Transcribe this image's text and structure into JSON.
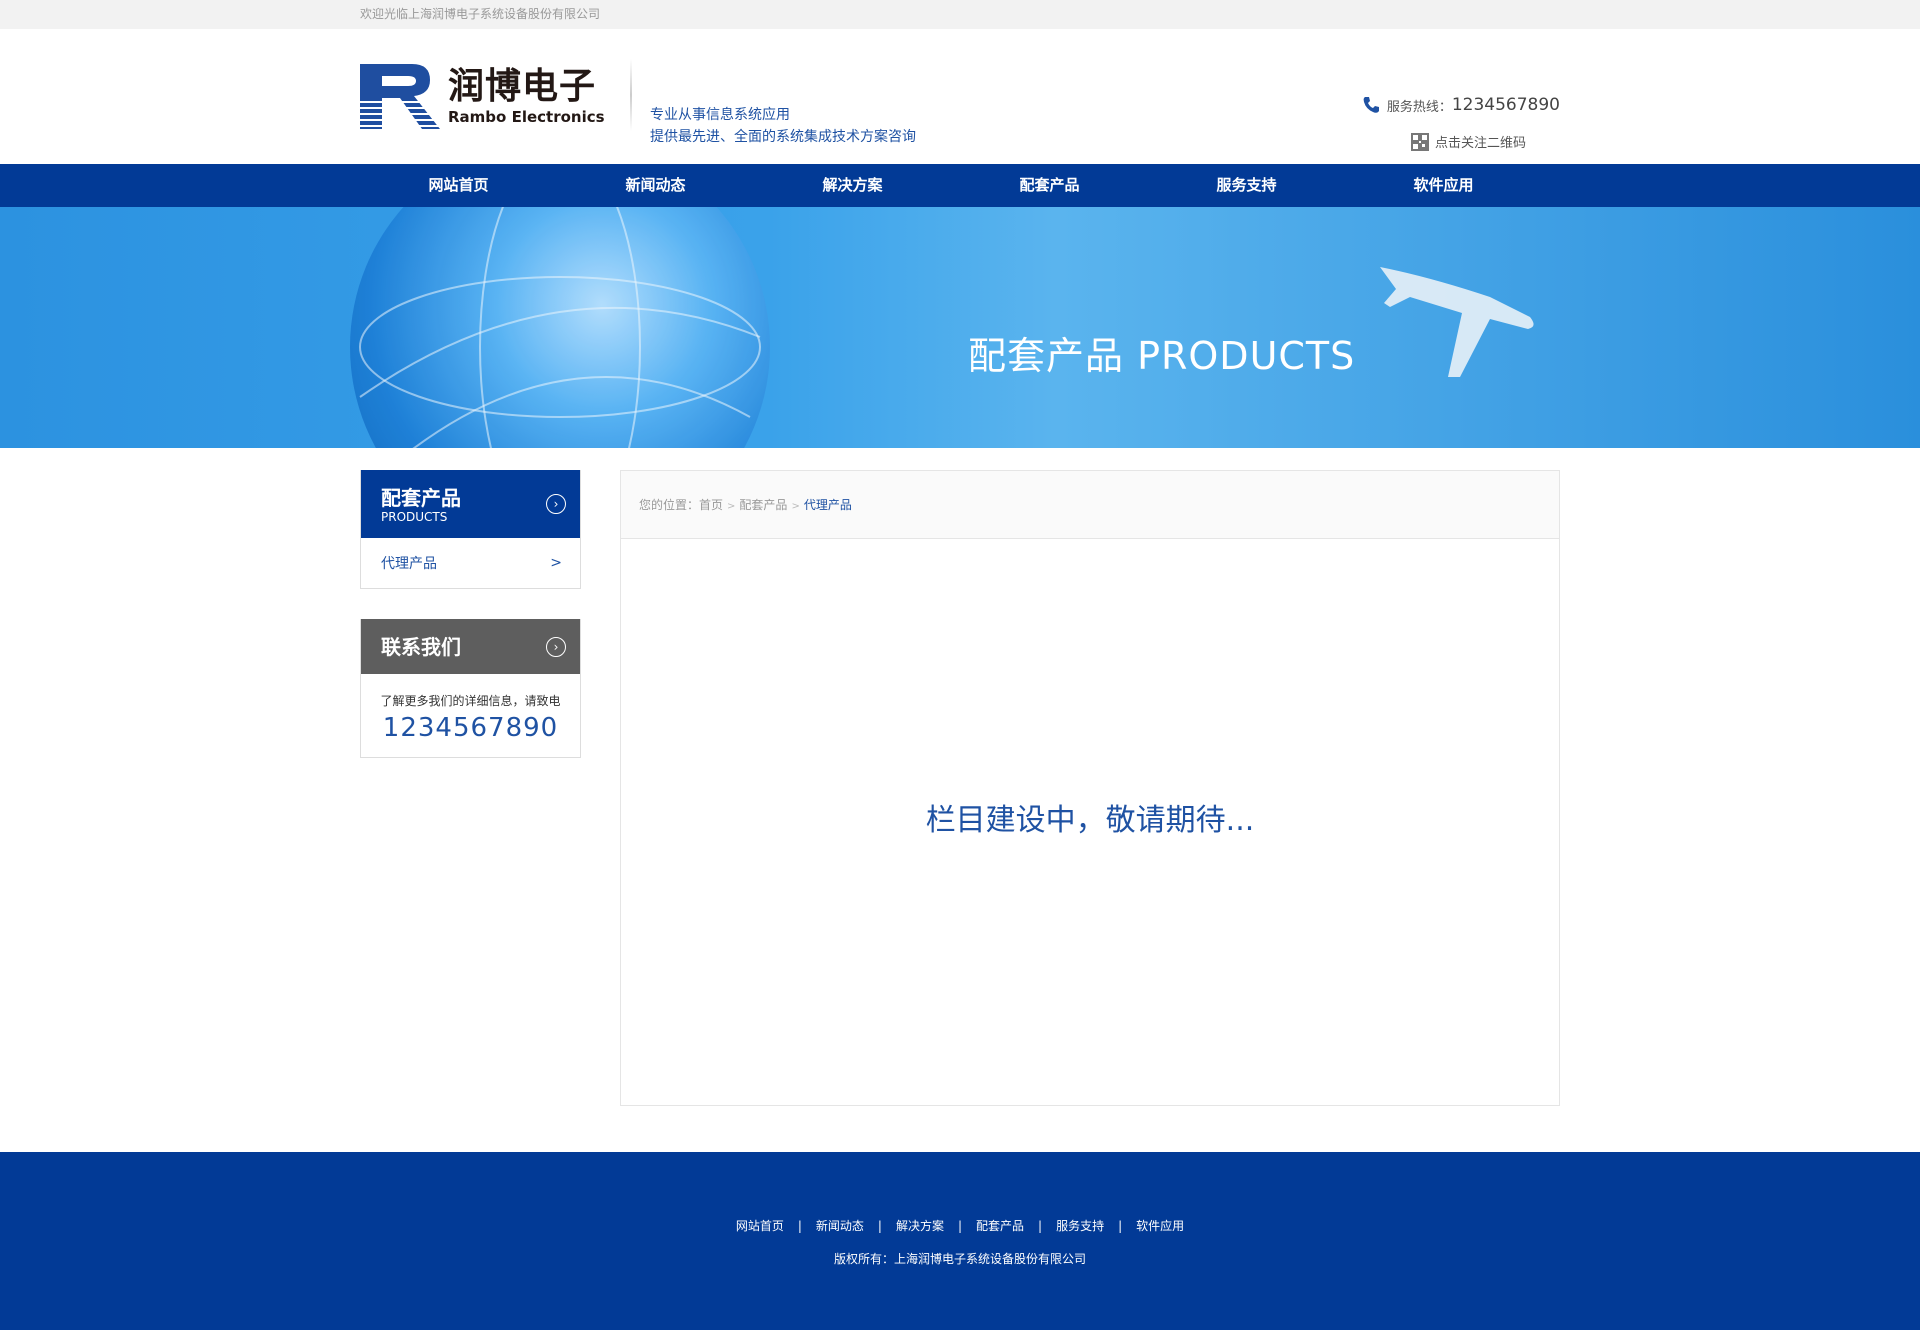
{
  "topbar": {
    "welcome": "欢迎光临上海润博电子系统设备股份有限公司"
  },
  "header": {
    "logo_cn": "润博电子",
    "logo_en": "Rambo Electronics",
    "slogan_line1": "专业从事信息系统应用",
    "slogan_line2": "提供最先进、全面的系统集成技术方案咨询",
    "hotline_label": "服务热线：",
    "hotline_number": "1234567890",
    "qr_label": "点击关注二维码",
    "brand_color": "#023a96"
  },
  "nav": {
    "items": [
      "网站首页",
      "新闻动态",
      "解决方案",
      "配套产品",
      "服务支持",
      "软件应用"
    ]
  },
  "banner": {
    "title": "配套产品 PRODUCTS"
  },
  "sidebar": {
    "category_title": "配套产品",
    "category_subtitle": "PRODUCTS",
    "items": [
      {
        "label": "代理产品",
        "arrow": ">"
      }
    ],
    "contact_title": "联系我们",
    "contact_desc": "了解更多我们的详细信息，请致电",
    "contact_phone": "1234567890"
  },
  "breadcrumb": {
    "prefix": "您的位置：",
    "items": [
      "首页",
      "配套产品",
      "代理产品"
    ],
    "separator": ">"
  },
  "content": {
    "message": "栏目建设中，敬请期待..."
  },
  "footer": {
    "links": [
      "网站首页",
      "新闻动态",
      "解决方案",
      "配套产品",
      "服务支持",
      "软件应用"
    ],
    "divider": "|",
    "copyright": "版权所有：上海润博电子系统设备股份有限公司"
  }
}
